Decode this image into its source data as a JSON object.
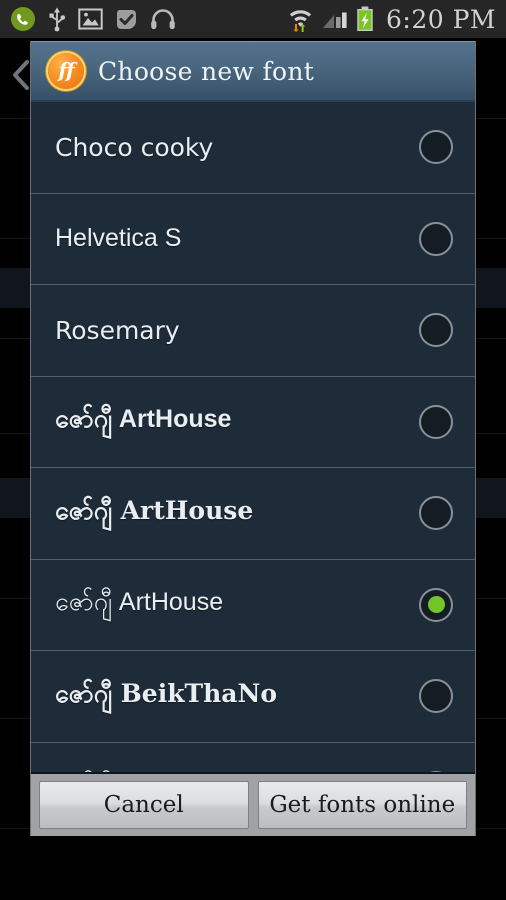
{
  "statusbar": {
    "time": "6:20 PM",
    "left_icons": [
      {
        "name": "phone-icon",
        "label": "phone"
      },
      {
        "name": "usb-icon",
        "label": "usb"
      },
      {
        "name": "image-icon",
        "label": "gallery"
      },
      {
        "name": "checkmark-icon",
        "label": "completed"
      },
      {
        "name": "headset-icon",
        "label": "headset"
      }
    ],
    "right_icons": [
      {
        "name": "wifi-icon",
        "label": "wifi"
      },
      {
        "name": "signal-icon",
        "label": "mobile-signal"
      },
      {
        "name": "battery-charging-icon",
        "label": "battery charging"
      }
    ]
  },
  "navigation": {
    "back_chevron": "‹"
  },
  "dialog": {
    "logo_text": "ff",
    "title": "Choose new font",
    "fonts": [
      {
        "label": "Choco cooky",
        "style": "f-rounded",
        "selected": false
      },
      {
        "label": "Helvetica S",
        "style": "f-sans",
        "selected": false
      },
      {
        "label": "Rosemary",
        "style": "f-rounded",
        "selected": false
      },
      {
        "label": "ဇော်ဂျီ ArtHouse",
        "style": "f-bold",
        "selected": false
      },
      {
        "label": "ဇော်ဂျီ ArtHouse",
        "style": "f-boldser",
        "selected": false
      },
      {
        "label": "ဇော်ဂျီ ArtHouse",
        "style": "f-sans",
        "selected": true
      },
      {
        "label": "ဇော်ဂျီ BeikThaNo",
        "style": "f-boldser",
        "selected": false
      },
      {
        "label": "ဇော်ဂျီ PyinOoLwin",
        "style": "f-rounded",
        "selected": false
      }
    ],
    "buttons": {
      "cancel": "Cancel",
      "get_fonts_online": "Get fonts online"
    }
  },
  "colors": {
    "header_gradient_top": "#53738e",
    "header_gradient_bottom": "#37506a",
    "list_background": "#1e2b38",
    "divider": "#55606a",
    "selected_radio": "#72c52b",
    "logo_orange": "#f79023",
    "button_bar": "#a0a2a5",
    "status_bar": "#262626"
  }
}
